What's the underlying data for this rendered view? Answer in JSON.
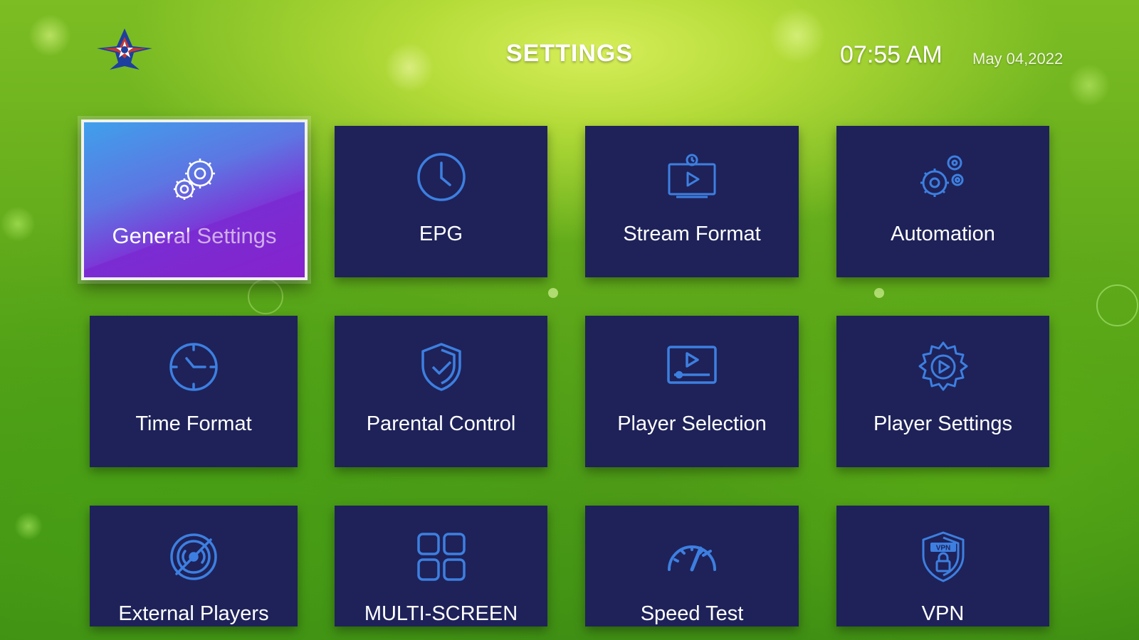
{
  "header": {
    "title": "SETTINGS",
    "time": "07:55 AM",
    "date": "May 04,2022",
    "logo_icon": "fighter-jet-star-logo"
  },
  "tiles": [
    {
      "label": "General Settings",
      "icon": "gears-icon",
      "selected": true
    },
    {
      "label": "EPG",
      "icon": "clock-icon",
      "selected": false
    },
    {
      "label": "Stream Format",
      "icon": "tv-play-icon",
      "selected": false
    },
    {
      "label": "Automation",
      "icon": "automation-gears-icon",
      "selected": false
    },
    {
      "label": "Time Format",
      "icon": "time-clock-icon",
      "selected": false
    },
    {
      "label": "Parental Control",
      "icon": "shield-check-icon",
      "selected": false
    },
    {
      "label": "Player Selection",
      "icon": "player-screen-icon",
      "selected": false
    },
    {
      "label": "Player Settings",
      "icon": "play-gear-icon",
      "selected": false
    },
    {
      "label": "External Players",
      "icon": "external-player-icon",
      "selected": false
    },
    {
      "label": "MULTI-SCREEN",
      "icon": "grid-four-icon",
      "selected": false
    },
    {
      "label": "Speed Test",
      "icon": "speedometer-icon",
      "selected": false
    },
    {
      "label": "VPN",
      "icon": "vpn-shield-lock-icon",
      "selected": false
    }
  ],
  "colors": {
    "tile": "#1e2259",
    "icon": "#3d7fe0",
    "active_gradient_start": "#3fa0ec",
    "active_gradient_end": "#8e2ad0"
  }
}
